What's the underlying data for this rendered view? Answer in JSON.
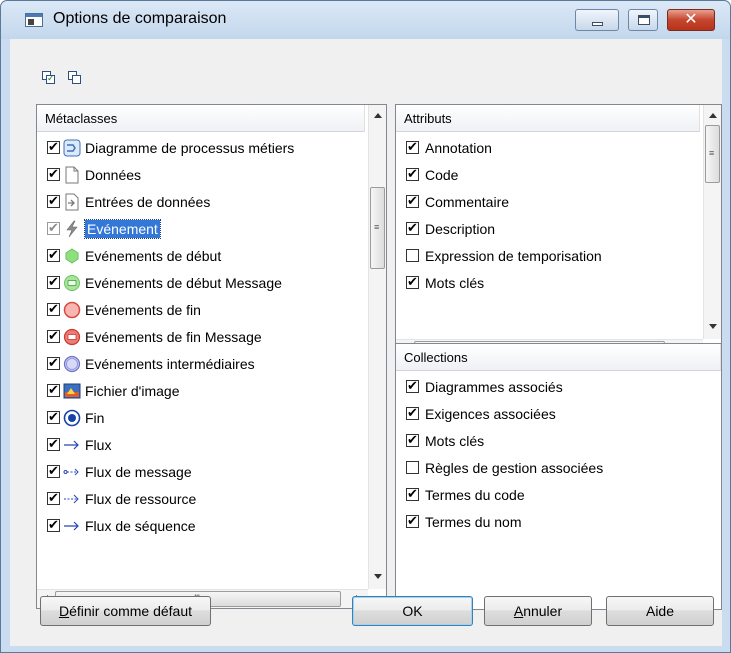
{
  "window": {
    "title": "Options de comparaison"
  },
  "toolbar": {
    "icons": [
      "select-all-icon",
      "deselect-all-icon"
    ]
  },
  "metaclasses": {
    "header": "Métaclasses",
    "items": [
      {
        "label": "Diagramme de processus métiers",
        "checked": true,
        "icon": "process-diagram-icon"
      },
      {
        "label": "Données",
        "checked": true,
        "icon": "document-icon"
      },
      {
        "label": "Entrées de données",
        "checked": true,
        "icon": "data-input-icon"
      },
      {
        "label": "Evénement",
        "checked": true,
        "icon": "lightning-icon",
        "selected": true,
        "disabled": true
      },
      {
        "label": "Evénements de début",
        "checked": true,
        "icon": "start-event-icon"
      },
      {
        "label": "Evénements de début Message",
        "checked": true,
        "icon": "start-message-event-icon"
      },
      {
        "label": "Evénements de fin",
        "checked": true,
        "icon": "end-event-icon"
      },
      {
        "label": "Evénements de fin Message",
        "checked": true,
        "icon": "end-message-event-icon"
      },
      {
        "label": "Evénements intermédiaires",
        "checked": true,
        "icon": "intermediate-event-icon"
      },
      {
        "label": "Fichier d'image",
        "checked": true,
        "icon": "image-file-icon"
      },
      {
        "label": "Fin",
        "checked": true,
        "icon": "end-icon"
      },
      {
        "label": "Flux",
        "checked": true,
        "icon": "flow-arrow-icon"
      },
      {
        "label": "Flux de message",
        "checked": true,
        "icon": "message-flow-icon"
      },
      {
        "label": "Flux de ressource",
        "checked": true,
        "icon": "resource-flow-icon"
      },
      {
        "label": "Flux de séquence",
        "checked": true,
        "icon": "sequence-flow-icon"
      }
    ]
  },
  "attributes": {
    "header": "Attributs",
    "items": [
      {
        "label": "Annotation",
        "checked": true
      },
      {
        "label": "Code",
        "checked": true
      },
      {
        "label": "Commentaire",
        "checked": true
      },
      {
        "label": "Description",
        "checked": true
      },
      {
        "label": "Expression de temporisation",
        "checked": false
      },
      {
        "label": "Mots clés",
        "checked": true
      }
    ]
  },
  "collections": {
    "header": "Collections",
    "items": [
      {
        "label": "Diagrammes associés",
        "checked": true
      },
      {
        "label": "Exigences associées",
        "checked": true
      },
      {
        "label": "Mots clés",
        "checked": true
      },
      {
        "label": "Règles de gestion associées",
        "checked": false
      },
      {
        "label": "Termes du code",
        "checked": true
      },
      {
        "label": "Termes du nom",
        "checked": true
      }
    ]
  },
  "buttons": {
    "default_prefix": "D",
    "default_rest": "éfinir comme défaut",
    "ok": "OK",
    "cancel_prefix": "A",
    "cancel_rest": "nnuler",
    "help": "Aide"
  },
  "colors": {
    "selection": "#3378d6",
    "frame": "#c9dcf0",
    "close_button": "#c6452d"
  }
}
